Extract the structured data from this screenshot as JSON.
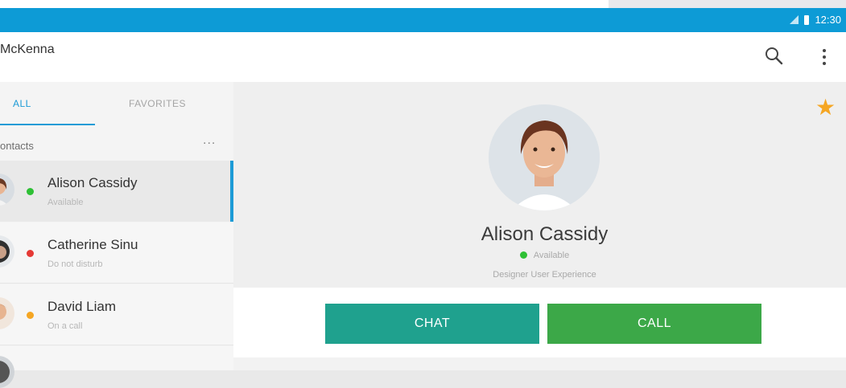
{
  "status_bar": {
    "time": "12:30"
  },
  "app_bar": {
    "title": "McKenna"
  },
  "tabs": [
    {
      "label": "ALL"
    },
    {
      "label": "FAVORITES"
    }
  ],
  "contacts_section": {
    "label": "ontacts",
    "more_label": "..."
  },
  "contacts": [
    {
      "name": "Alison Cassidy",
      "status": "Available",
      "status_color": "#2ec035"
    },
    {
      "name": "Catherine Sinu",
      "status": "Do not disturb",
      "status_color": "#e53935"
    },
    {
      "name": "David Liam",
      "status": "On a call",
      "status_color": "#f5a623"
    }
  ],
  "profile": {
    "name": "Alison Cassidy",
    "status": "Available",
    "title": "Designer User Experience",
    "favorite": true
  },
  "actions": {
    "chat_label": "CHAT",
    "call_label": "CALL"
  },
  "colors": {
    "accent": "#0d9bd6",
    "chat": "#1fa18e",
    "call": "#3ca848",
    "star": "#f5a623"
  },
  "icons": {
    "search": "search-icon",
    "menu": "more-vert-icon",
    "favorite": "star-icon"
  }
}
